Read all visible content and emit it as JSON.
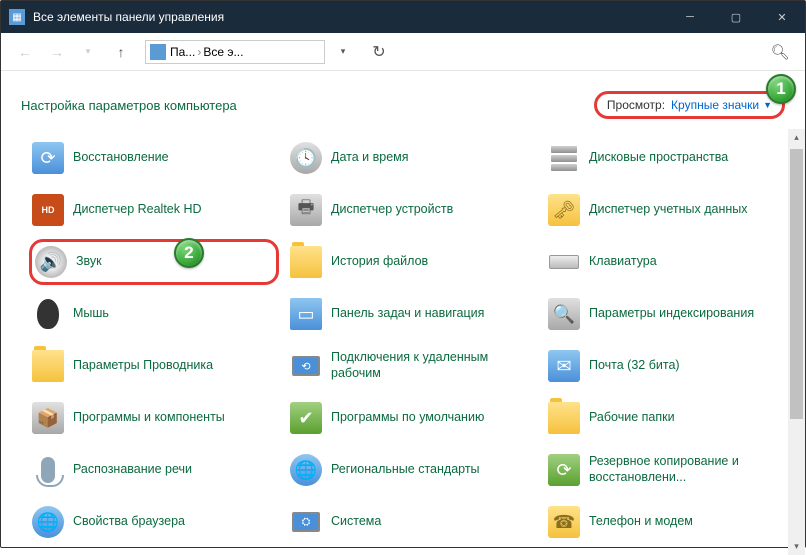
{
  "window": {
    "title": "Все элементы панели управления"
  },
  "breadcrumb": {
    "part1": "Па...",
    "part2": "Все э..."
  },
  "header": {
    "title": "Настройка параметров компьютера",
    "view_label": "Просмотр:",
    "view_value": "Крупные значки"
  },
  "markers": {
    "m1": "1",
    "m2": "2"
  },
  "items": [
    {
      "label": "Восстановление",
      "icon": "recovery"
    },
    {
      "label": "Дата и время",
      "icon": "datetime"
    },
    {
      "label": "Дисковые пространства",
      "icon": "storage"
    },
    {
      "label": "Диспетчер Realtek HD",
      "icon": "realtek"
    },
    {
      "label": "Диспетчер устройств",
      "icon": "devmgr"
    },
    {
      "label": "Диспетчер учетных данных",
      "icon": "credmgr"
    },
    {
      "label": "Звук",
      "icon": "sound",
      "highlight": true
    },
    {
      "label": "История файлов",
      "icon": "filehist"
    },
    {
      "label": "Клавиатура",
      "icon": "keyboard"
    },
    {
      "label": "Мышь",
      "icon": "mouse"
    },
    {
      "label": "Панель задач и навигация",
      "icon": "taskbar"
    },
    {
      "label": "Параметры индексирования",
      "icon": "indexing"
    },
    {
      "label": "Параметры Проводника",
      "icon": "explorer"
    },
    {
      "label": "Подключения к удаленным рабочим",
      "icon": "remoteapp"
    },
    {
      "label": "Почта (32 бита)",
      "icon": "mail"
    },
    {
      "label": "Программы и компоненты",
      "icon": "programs"
    },
    {
      "label": "Программы по умолчанию",
      "icon": "defaults"
    },
    {
      "label": "Рабочие папки",
      "icon": "workfolders"
    },
    {
      "label": "Распознавание речи",
      "icon": "speech"
    },
    {
      "label": "Региональные стандарты",
      "icon": "region"
    },
    {
      "label": "Резервное копирование и восстановлени...",
      "icon": "backup"
    },
    {
      "label": "Свойства браузера",
      "icon": "inetopt"
    },
    {
      "label": "Система",
      "icon": "system"
    },
    {
      "label": "Телефон и модем",
      "icon": "phone"
    }
  ]
}
